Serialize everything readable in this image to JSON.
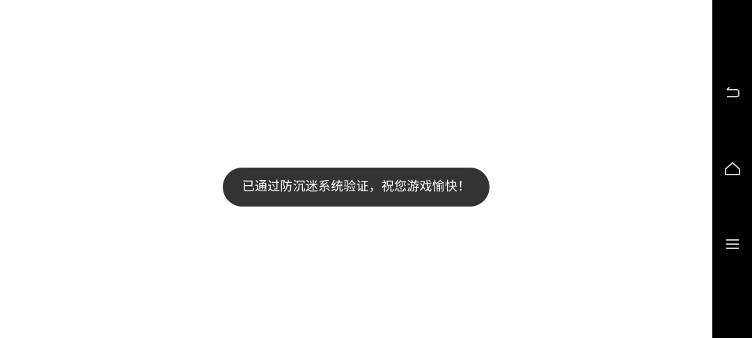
{
  "toast": {
    "message": "已通过防沉迷系统验证，祝您游戏愉快！"
  },
  "navbar": {
    "buttons": [
      {
        "icon": "back-icon"
      },
      {
        "icon": "home-icon"
      },
      {
        "icon": "menu-icon"
      }
    ]
  },
  "colors": {
    "background": "#ffffff",
    "toast_background": "#333333",
    "toast_text": "#ffffff",
    "navbar_background": "#000000",
    "navbar_icon": "#cfcfcf"
  }
}
